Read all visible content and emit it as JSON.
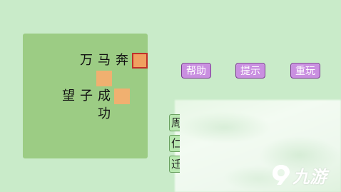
{
  "board": {
    "cells": [
      {
        "row": 0,
        "col": 0,
        "char": "万",
        "state": "text"
      },
      {
        "row": 0,
        "col": 1,
        "char": "马",
        "state": "text"
      },
      {
        "row": 0,
        "col": 2,
        "char": "奔",
        "state": "text"
      },
      {
        "row": 0,
        "col": 3,
        "char": "",
        "state": "selected"
      },
      {
        "row": 1,
        "col": 1,
        "char": "",
        "state": "blank"
      },
      {
        "row": 2,
        "col": -1,
        "char": "望",
        "state": "text"
      },
      {
        "row": 2,
        "col": 0,
        "char": "子",
        "state": "text"
      },
      {
        "row": 2,
        "col": 1,
        "char": "成",
        "state": "text"
      },
      {
        "row": 2,
        "col": 2,
        "char": "",
        "state": "blank"
      },
      {
        "row": 3,
        "col": 1,
        "char": "功",
        "state": "text"
      }
    ]
  },
  "buttons": {
    "help": "帮助",
    "hint": "提示",
    "restart": "重玩"
  },
  "options": [
    {
      "char": "周"
    },
    {
      "char": "仁"
    },
    {
      "char": "迁"
    }
  ],
  "watermark": {
    "text": "九游"
  },
  "colors": {
    "background": "#c9ebc9",
    "board": "#9ccc84",
    "blank_cell": "#f0b070",
    "selected_border": "#c0302a",
    "button": "#c98fe0"
  }
}
